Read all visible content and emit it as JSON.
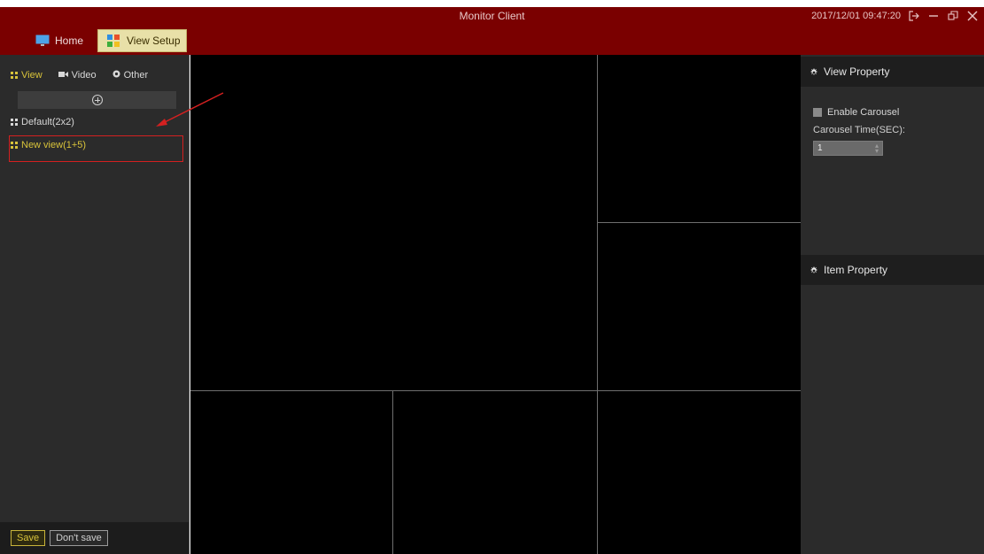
{
  "window": {
    "title": "Monitor Client",
    "datetime": "2017/12/01 09:47:20"
  },
  "main_tabs": [
    {
      "label": "Home",
      "active": false
    },
    {
      "label": "View Setup",
      "active": true
    }
  ],
  "left_panel": {
    "subtabs": [
      {
        "label": "View",
        "icon": "grid-icon",
        "active": true
      },
      {
        "label": "Video",
        "icon": "camera-icon",
        "active": false
      },
      {
        "label": "Other",
        "icon": "settings-icon",
        "active": false
      }
    ],
    "views": [
      {
        "label": "Default(2x2)",
        "selected": false
      },
      {
        "label": "New view(1+5)",
        "selected": true
      }
    ],
    "save_label": "Save",
    "dont_save_label": "Don't save"
  },
  "right_panel": {
    "view_property_title": "View Property",
    "enable_carousel_label": "Enable Carousel",
    "carousel_time_label": "Carousel Time(SEC):",
    "carousel_time_value": "1",
    "item_property_title": "Item Property"
  },
  "colors": {
    "header": "#7a0000",
    "accent": "#d8c33a",
    "panel": "#2b2b2b",
    "annotation": "#d42020"
  }
}
